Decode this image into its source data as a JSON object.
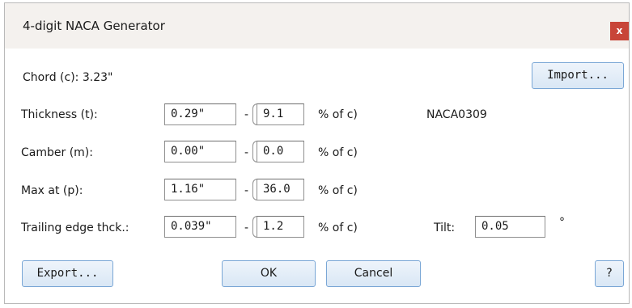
{
  "window": {
    "title": "4-digit NACA Generator",
    "close_label": "x"
  },
  "chord": {
    "label": "Chord (c): 3.23\""
  },
  "buttons": {
    "import": "Import...",
    "export": "Export...",
    "ok": "OK",
    "cancel": "Cancel",
    "help": "?"
  },
  "rows": {
    "thickness": {
      "label": "Thickness (t):",
      "abs": "0.29\"",
      "dash": "- (",
      "pct": "9.1",
      "suffix": "% of c)"
    },
    "camber": {
      "label": "Camber (m):",
      "abs": "0.00\"",
      "dash": "- (",
      "pct": "0.0",
      "suffix": "% of c)"
    },
    "max_at": {
      "label": "Max at (p):",
      "abs": "1.16\"",
      "dash": "- (",
      "pct": "36.0",
      "suffix": "% of c)"
    },
    "trailing": {
      "label": "Trailing edge thck.:",
      "abs": "0.039\"",
      "dash": "- (",
      "pct": "1.2",
      "suffix": "% of c)"
    }
  },
  "naca_code": "NACA0309",
  "tilt": {
    "label": "Tilt:",
    "value": "0.05",
    "unit": "°"
  }
}
